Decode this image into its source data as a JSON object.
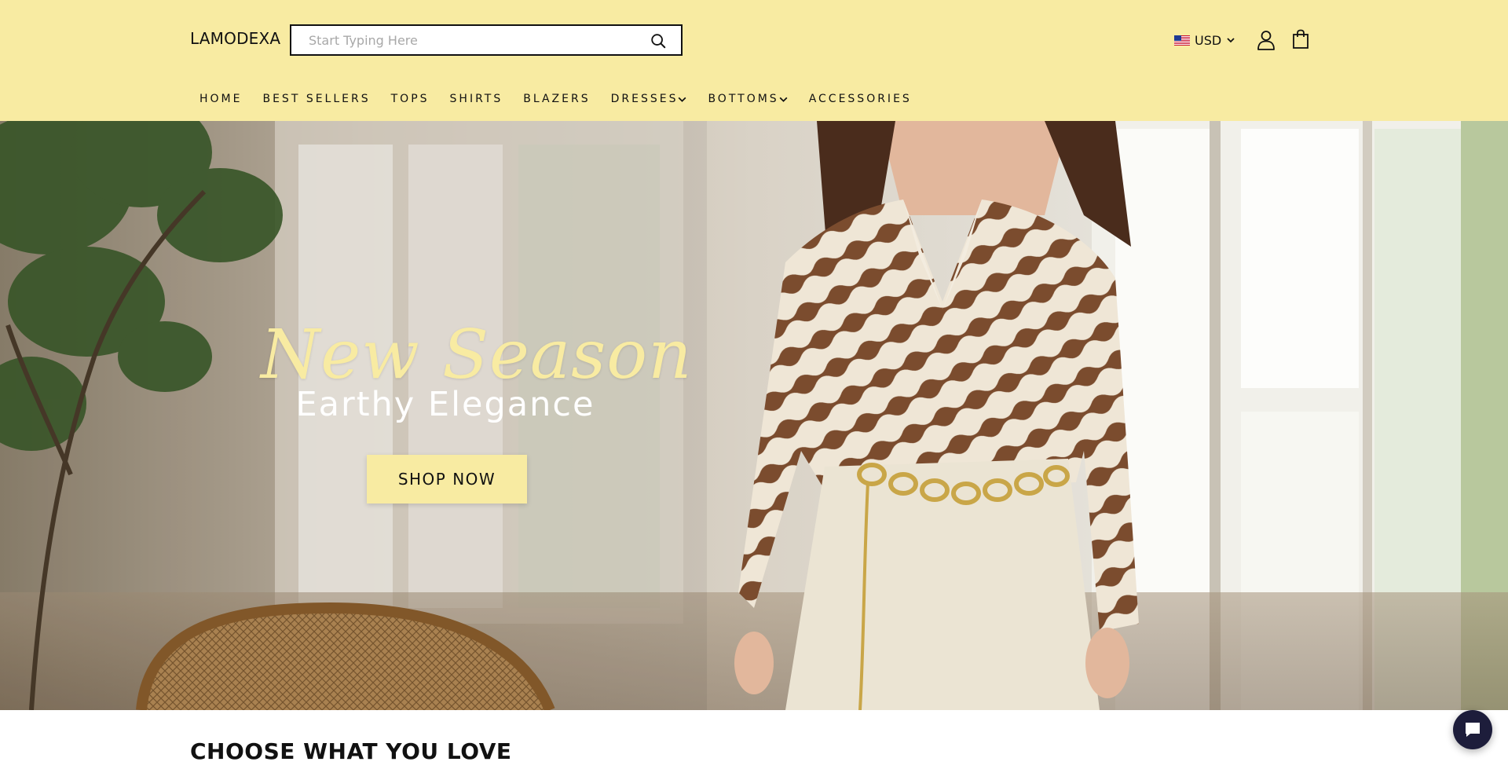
{
  "header": {
    "logo": "LAMODEXA",
    "search": {
      "placeholder": "Start Typing Here",
      "value": ""
    },
    "currency": {
      "code": "USD",
      "flag": "us-flag-icon"
    },
    "icons": [
      "search-icon",
      "user-icon",
      "shopping-bag-icon",
      "chevron-down-icon"
    ]
  },
  "nav": {
    "items": [
      {
        "label": "HOME",
        "dropdown": false
      },
      {
        "label": "BEST SELLERS",
        "dropdown": false
      },
      {
        "label": "TOPS",
        "dropdown": false
      },
      {
        "label": "SHIRTS",
        "dropdown": false
      },
      {
        "label": "BLAZERS",
        "dropdown": false
      },
      {
        "label": "DRESSES",
        "dropdown": true
      },
      {
        "label": "BOTTOMS",
        "dropdown": true
      },
      {
        "label": "ACCESSORIES",
        "dropdown": false
      }
    ]
  },
  "hero": {
    "script_title": "New Season",
    "subtitle": "Earthy Elegance",
    "cta_label": "SHOP NOW"
  },
  "section": {
    "title": "CHOOSE WHAT YOU LOVE"
  },
  "chat": {
    "icon": "chat-bubble-icon"
  },
  "colors": {
    "header_bg": "#f8eba2",
    "accent": "#f8eba2",
    "text": "#111111",
    "chat_bg": "#1d1d3b"
  }
}
